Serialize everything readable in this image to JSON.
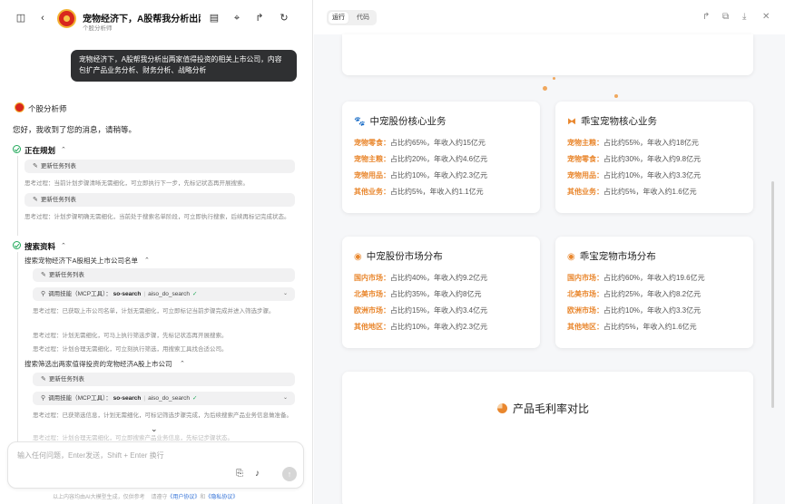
{
  "header": {
    "title": "宠物经济下，A股帮我分析出两...",
    "subtitle": "个股分析师"
  },
  "chat": {
    "user_message": "宠物经济下，A股帮我分析出两家值得投资的相关上市公司，内容包扩产品业务分析、财务分析、战略分析",
    "bot_name": "个股分析师",
    "greeting": "您好，我收到了您的消息，请稍等。",
    "planning": {
      "title": "正在规划",
      "items": [
        {
          "task": "更新任务列表",
          "thought": "思考过程：当前计划步骤清晰无需细化，可立即执行下一步，先标记状态再开展搜索。"
        },
        {
          "task": "更新任务列表",
          "thought": "思考过程：计划步骤明确无需细化，当前处于搜索名单阶段，可立即执行搜索，后续再标记完成状态。"
        }
      ]
    },
    "search": {
      "title": "搜索资料",
      "groups": [
        {
          "title": "搜索宠物经济下A股相关上市公司名单",
          "task": "更新任务列表",
          "tool_label": "调用技能（MCP工具）：",
          "tool_name": "so-search",
          "tool_fn": "aiso_do_search",
          "thoughts": [
            "思考过程：已获取上市公司名单，计划无需细化，可立即标记当前步骤完成并进入筛选步骤。",
            "思考过程：计划无需细化，可马上执行筛选步骤，先标记状态再开展搜索。",
            "思考过程：计划合理无需细化，可立刻执行筛选，用搜索工具找合适公司。"
          ]
        },
        {
          "title": "搜索筛选出两家值得投资的宠物经济A股上市公司",
          "task": "更新任务列表",
          "tool_label": "调用技能（MCP工具）：",
          "tool_name": "so-search",
          "tool_fn": "aiso_do_search",
          "thoughts": [
            "思考过程：已获筛选信息，计划无需细化，可标记筛选步骤完成，为后续搜索产品业务信息做准备。",
            "思考过程：计划合理无需细化，可立即搜索产品业务信息，先标记步骤状态。"
          ]
        }
      ]
    }
  },
  "input": {
    "placeholder": "输入任何问题，Enter发送，Shift + Enter 换行"
  },
  "footer": {
    "text": "以上内容均由AI大模型生成，仅供参考",
    "read_prefix": "请遵守",
    "link1": "《用户协议》",
    "and": "和",
    "link2": "《隐私协议》"
  },
  "preview": {
    "tabs": {
      "run": "运行",
      "code": "代码"
    },
    "accent_color": "#e9872e",
    "cards": [
      {
        "icon": "paw-icon",
        "title": "中宠股份核心业务",
        "rows": [
          {
            "k": "宠物零食：",
            "v": "占比约65%，年收入约15亿元"
          },
          {
            "k": "宠物主粮：",
            "v": "占比约20%，年收入约4.6亿元"
          },
          {
            "k": "宠物用品：",
            "v": "占比约10%，年收入约2.3亿元"
          },
          {
            "k": "其他业务：",
            "v": "占比约5%，年收入约1.1亿元"
          }
        ]
      },
      {
        "icon": "bone-icon",
        "title": "乖宝宠物核心业务",
        "rows": [
          {
            "k": "宠物主粮：",
            "v": "占比约55%，年收入约18亿元"
          },
          {
            "k": "宠物零食：",
            "v": "占比约30%，年收入约9.8亿元"
          },
          {
            "k": "宠物用品：",
            "v": "占比约10%，年收入约3.3亿元"
          },
          {
            "k": "其他业务：",
            "v": "占比约5%，年收入约1.6亿元"
          }
        ]
      },
      {
        "icon": "globe-icon",
        "title": "中宠股份市场分布",
        "rows": [
          {
            "k": "国内市场：",
            "v": "占比约40%，年收入约9.2亿元"
          },
          {
            "k": "北美市场：",
            "v": "占比约35%，年收入约8亿元"
          },
          {
            "k": "欧洲市场：",
            "v": "占比约15%，年收入约3.4亿元"
          },
          {
            "k": "其他地区：",
            "v": "占比约10%，年收入约2.3亿元"
          }
        ]
      },
      {
        "icon": "globe-icon",
        "title": "乖宝宠物市场分布",
        "rows": [
          {
            "k": "国内市场：",
            "v": "占比约60%，年收入约19.6亿元"
          },
          {
            "k": "北美市场：",
            "v": "占比约25%，年收入约8.2亿元"
          },
          {
            "k": "欧洲市场：",
            "v": "占比约10%，年收入约3.3亿元"
          },
          {
            "k": "其他地区：",
            "v": "占比约5%，年收入约1.6亿元"
          }
        ]
      }
    ],
    "margin_title": "产品毛利率对比"
  }
}
